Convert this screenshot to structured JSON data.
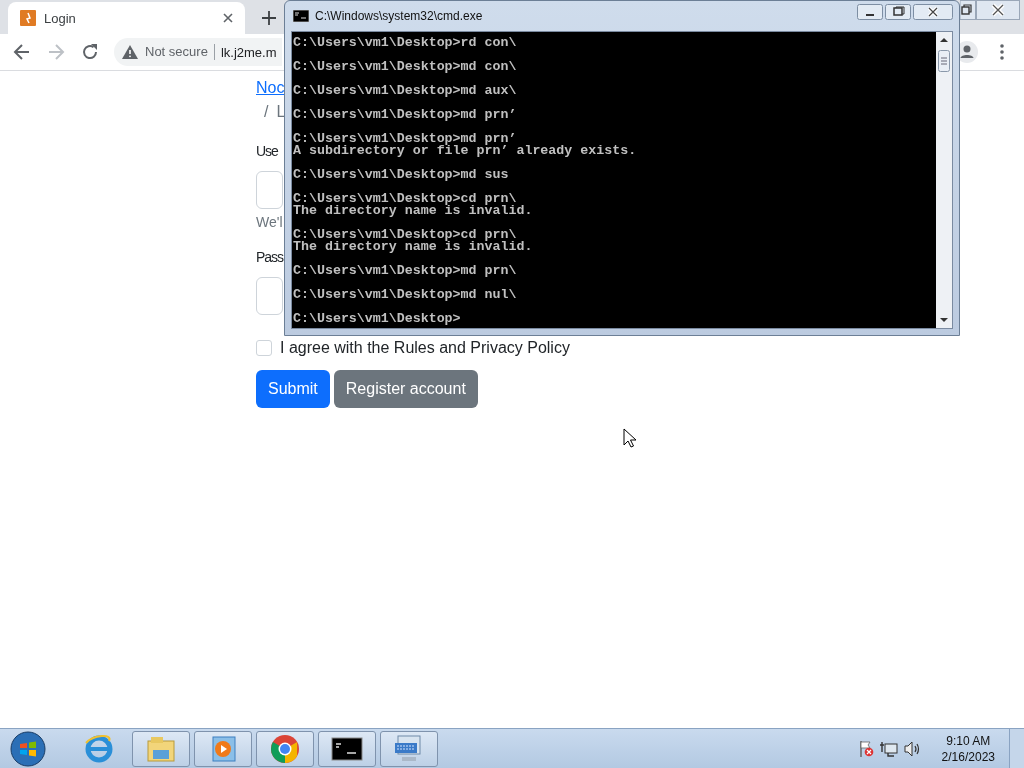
{
  "browser": {
    "tab": {
      "title": "Login"
    },
    "nav": [
      {
        "kind": "back",
        "disabled": false
      },
      {
        "kind": "forward",
        "disabled": true
      },
      {
        "kind": "reload",
        "disabled": false
      }
    ],
    "address": {
      "security": "Not secure",
      "url": "lk.j2me.m"
    },
    "breadcrumb": [
      {
        "label": "Noc",
        "kind": "link"
      },
      {
        "label": "L",
        "kind": "current",
        "separator": "/"
      }
    ],
    "form": {
      "username_label": "Use",
      "username_help": "We'l",
      "password_label": "Pass",
      "agree": {
        "label": "I agree with the Rules and Privacy Policy",
        "checked": false
      },
      "buttons": [
        {
          "label": "Submit",
          "kind": "primary"
        },
        {
          "label": "Register account",
          "kind": "secondary"
        }
      ]
    }
  },
  "console": {
    "title": "C:\\Windows\\system32\\cmd.exe",
    "blocks": [
      [
        "C:\\Users\\vm1\\Desktop>rd con\\"
      ],
      [
        "C:\\Users\\vm1\\Desktop>md con\\"
      ],
      [
        "C:\\Users\\vm1\\Desktop>md aux\\"
      ],
      [
        "C:\\Users\\vm1\\Desktop>md prn’"
      ],
      [
        "C:\\Users\\vm1\\Desktop>md prn’",
        "A subdirectory or file prn’ already exists."
      ],
      [
        "C:\\Users\\vm1\\Desktop>md sus"
      ],
      [
        "C:\\Users\\vm1\\Desktop>cd prn\\",
        "The directory name is invalid."
      ],
      [
        "C:\\Users\\vm1\\Desktop>cd prn\\",
        "The directory name is invalid."
      ],
      [
        "C:\\Users\\vm1\\Desktop>md prn\\"
      ],
      [
        "C:\\Users\\vm1\\Desktop>md nul\\"
      ],
      [
        "C:\\Users\\vm1\\Desktop>"
      ]
    ]
  },
  "taskbar": {
    "items": [
      {
        "kind": "ie",
        "running": false
      },
      {
        "kind": "explorer",
        "running": true
      },
      {
        "kind": "media",
        "running": true
      },
      {
        "kind": "chrome",
        "running": true
      },
      {
        "kind": "cmd",
        "running": true
      },
      {
        "kind": "keyboard",
        "running": true
      }
    ],
    "clock": {
      "time": "9:10 AM",
      "date": "2/16/2023"
    }
  }
}
